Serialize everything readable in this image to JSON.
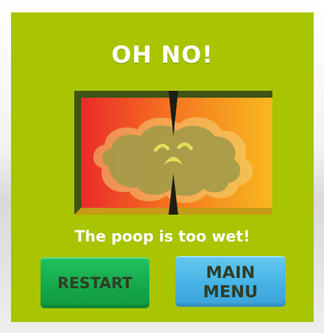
{
  "dialog": {
    "title": "OH NO!",
    "message": "The poop is too wet!"
  },
  "meter": {
    "gradient_colors": [
      "#ea2a2a",
      "#f6791f",
      "#f7b820"
    ],
    "frame_color": "#3e5416",
    "needle_color": "#1e1e14"
  },
  "buttons": {
    "restart_label": "RESTART",
    "main_menu_line1": "MAIN",
    "main_menu_line2": "MENU"
  },
  "colors": {
    "panel": "#a9c400",
    "restart_button": "#18aa4b",
    "menu_button": "#4ab6e8",
    "button_text": "#2f3d27"
  },
  "icons": {
    "character": "sad-poop-icon"
  }
}
